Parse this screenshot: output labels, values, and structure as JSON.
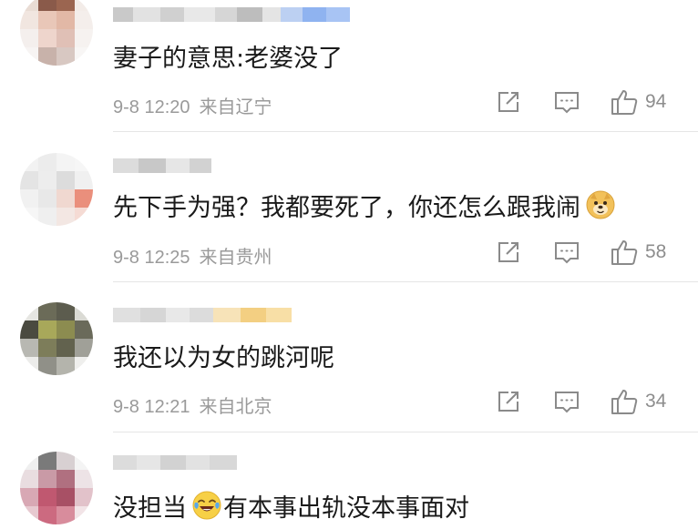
{
  "comments": [
    {
      "text": "妻子的意思:老婆没了",
      "date": "9-8 12:20",
      "location": "来自辽宁",
      "likes": "94"
    },
    {
      "text": "先下手为强？我都要死了，你还怎么跟我闹",
      "date": "9-8 12:25",
      "location": "来自贵州",
      "likes": "58",
      "emoji": "doge-emoji"
    },
    {
      "text": "我还以为女的跳河呢",
      "date": "9-8 12:21",
      "location": "来自北京",
      "likes": "34"
    },
    {
      "text_before": "没担当",
      "emoji": "crying-laughing-emoji",
      "text_after": "有本事出轨没本事面对"
    }
  ],
  "icons": {
    "share": "share-icon",
    "comment": "comment-icon",
    "like": "thumbs-up-icon"
  },
  "colors": {
    "text": "#1a1a1a",
    "meta": "#9a9a9a",
    "icon": "#8a8a8a",
    "divider": "#e6e6e6"
  }
}
